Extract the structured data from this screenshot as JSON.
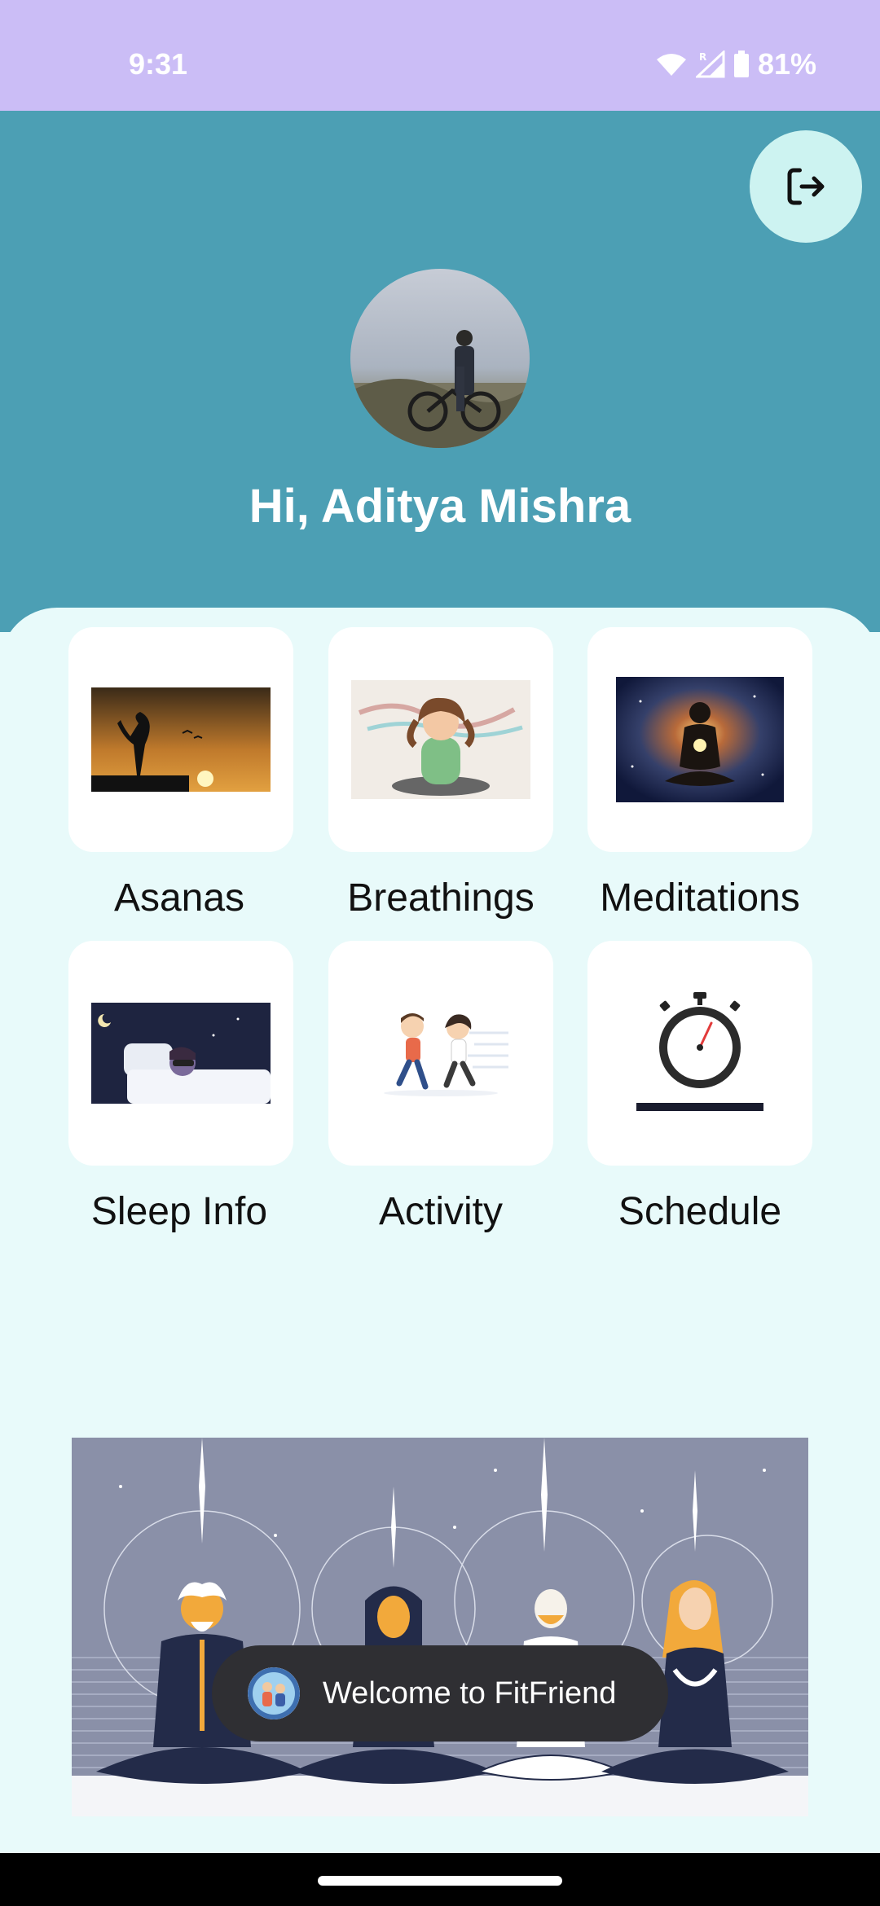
{
  "status_bar": {
    "time": "9:31",
    "battery": "81%",
    "icons": [
      "wifi-icon",
      "signal-icon",
      "battery-icon"
    ]
  },
  "header": {
    "greeting": "Hi, Aditya Mishra",
    "logout_icon": "logout-icon",
    "avatar_icon": "profile-photo",
    "background_color": "#4c9fb4"
  },
  "menu": {
    "items": [
      {
        "label": "Asanas",
        "icon": "yoga-pose-image"
      },
      {
        "label": "Breathings",
        "icon": "breathing-image"
      },
      {
        "label": "Meditations",
        "icon": "meditation-image"
      },
      {
        "label": "Sleep Info",
        "icon": "sleep-image"
      },
      {
        "label": "Activity",
        "icon": "running-image"
      },
      {
        "label": "Schedule",
        "icon": "stopwatch-image"
      }
    ]
  },
  "banner": {
    "icon": "group-meditation-illustration"
  },
  "toast": {
    "text": "Welcome to FitFriend",
    "icon": "app-icon"
  },
  "colors": {
    "status_bar": "#cbbdf6",
    "panel": "#e8fafa",
    "toast": "#2f2f33"
  }
}
